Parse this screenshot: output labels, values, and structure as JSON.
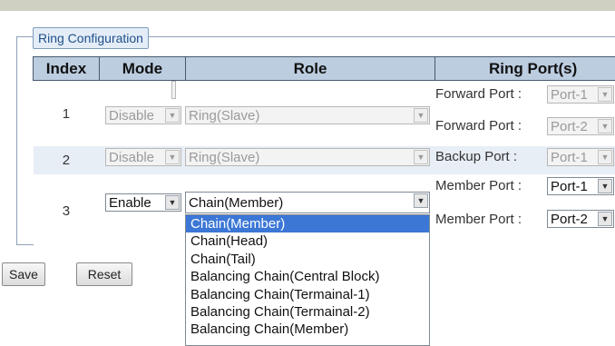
{
  "legend": "Ring Configuration",
  "headers": {
    "index": "Index",
    "mode": "Mode",
    "role": "Role",
    "ports": "Ring Port(s)"
  },
  "rows": [
    {
      "index": "1",
      "mode": "Disable",
      "role": "Ring(Slave)",
      "ports": [
        {
          "label": "Forward Port :",
          "value": "Port-1"
        },
        {
          "label": "Forward Port :",
          "value": "Port-2"
        }
      ]
    },
    {
      "index": "2",
      "mode": "Disable",
      "role": "Ring(Slave)",
      "ports": [
        {
          "label": "Backup Port :",
          "value": "Port-1"
        }
      ]
    },
    {
      "index": "3",
      "mode": "Enable",
      "role": "Chain(Member)",
      "ports": [
        {
          "label": "Member Port :",
          "value": "Port-1"
        },
        {
          "label": "Member Port :",
          "value": "Port-2"
        }
      ]
    }
  ],
  "role_dropdown": {
    "options": [
      "Chain(Member)",
      "Chain(Head)",
      "Chain(Tail)",
      "Balancing Chain(Central Block)",
      "Balancing Chain(Termainal-1)",
      "Balancing Chain(Termainal-2)",
      "Balancing Chain(Member)"
    ],
    "selected": "Chain(Member)"
  },
  "buttons": {
    "save": "Save",
    "reset": "Reset"
  },
  "icons": {
    "dropdown_arrow": "chevron-down-icon"
  },
  "colors": {
    "header_bg": "#bccde0",
    "row_alt_bg": "#e8eef6",
    "selection_bg": "#3c77d6",
    "legend_text": "#1f4f8a"
  }
}
